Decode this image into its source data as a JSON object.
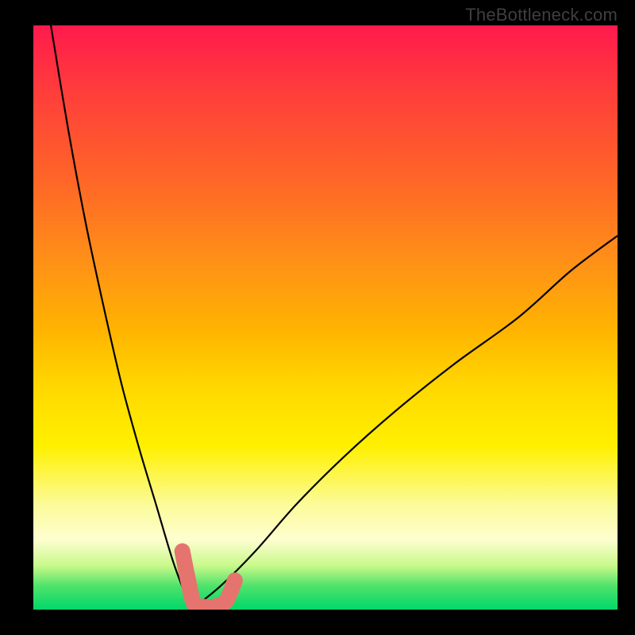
{
  "watermark": "TheBottleneck.com",
  "chart_data": {
    "type": "line",
    "title": "",
    "xlabel": "",
    "ylabel": "",
    "xlim": [
      0,
      100
    ],
    "ylim": [
      0,
      100
    ],
    "grid": false,
    "legend": false,
    "description": "Two black curves resembling a bottleneck V shape over a red-to-green vertical gradient. Left curve descends steeply from top-left to a minimum around x≈27, right curve rises from the same minimum toward upper-right reaching roughly y≈64 at x=100.",
    "series": [
      {
        "name": "left-curve",
        "x": [
          3,
          6,
          9,
          12,
          15,
          18,
          21,
          24,
          27
        ],
        "y": [
          100,
          82,
          66,
          52,
          39,
          28,
          18,
          8,
          0
        ]
      },
      {
        "name": "right-curve",
        "x": [
          27,
          32,
          38,
          45,
          53,
          62,
          72,
          83,
          92,
          100
        ],
        "y": [
          0,
          4,
          10,
          18,
          26,
          34,
          42,
          50,
          58,
          64
        ]
      }
    ],
    "highlight": {
      "description": "Salmon-colored thick marker segment around the curve minimum (pale red blobs forming a short U shape near bottom).",
      "color": "#e5746f",
      "x": [
        25.5,
        26.5,
        27.5,
        29,
        31,
        33,
        34.5
      ],
      "y": [
        10,
        5,
        1,
        0.5,
        0.5,
        1.5,
        5
      ]
    },
    "gradient_stops": [
      {
        "pos": 0.0,
        "color": "#ff1a4d"
      },
      {
        "pos": 0.12,
        "color": "#ff3f3a"
      },
      {
        "pos": 0.28,
        "color": "#ff6a25"
      },
      {
        "pos": 0.4,
        "color": "#ff8f18"
      },
      {
        "pos": 0.52,
        "color": "#ffb300"
      },
      {
        "pos": 0.62,
        "color": "#ffd800"
      },
      {
        "pos": 0.72,
        "color": "#fff000"
      },
      {
        "pos": 0.82,
        "color": "#fcfb99"
      },
      {
        "pos": 0.88,
        "color": "#fefed0"
      },
      {
        "pos": 0.925,
        "color": "#c8f98a"
      },
      {
        "pos": 0.96,
        "color": "#4ee26a"
      },
      {
        "pos": 1.0,
        "color": "#00d86a"
      }
    ]
  }
}
